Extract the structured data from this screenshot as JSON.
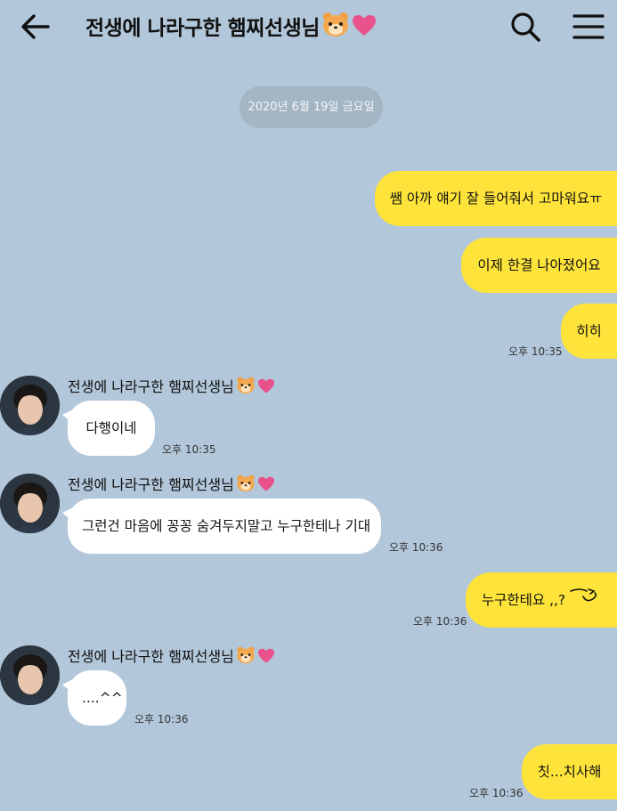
{
  "header": {
    "title": "전생에 나라구한 햄찌선생님",
    "back_icon": "arrow-left-icon",
    "search_icon": "search-icon",
    "menu_icon": "hamburger-menu-icon"
  },
  "date_divider": "2020년 6월 19일 금요일",
  "sender_name": "전생에 나라구한 햄찌선생님",
  "messages": [
    {
      "text": "쌤 아까 얘기 잘 들어줘서 고마워요ㅠ"
    },
    {
      "text": "이제 한결 나아졌어요"
    },
    {
      "text": "히히",
      "time": "오후 10:35"
    },
    {
      "text": "다행이네",
      "time": "오후 10:35"
    },
    {
      "text": "그런건 마음에 꽁꽁 숨겨두지말고 누구한테나 기대",
      "time": "오후 10:36"
    },
    {
      "text": "누구한테요 ,,?",
      "time": "오후 10:36"
    },
    {
      "text": "....^^",
      "time": "오후 10:36"
    },
    {
      "text": "칫...치사해",
      "time": "오후 10:36"
    }
  ],
  "colors": {
    "background": "#b2c7da",
    "my_bubble": "#fee33b",
    "other_bubble": "#ffffff",
    "date_pill": "#a4b5c4",
    "heart": "#e8518a"
  }
}
